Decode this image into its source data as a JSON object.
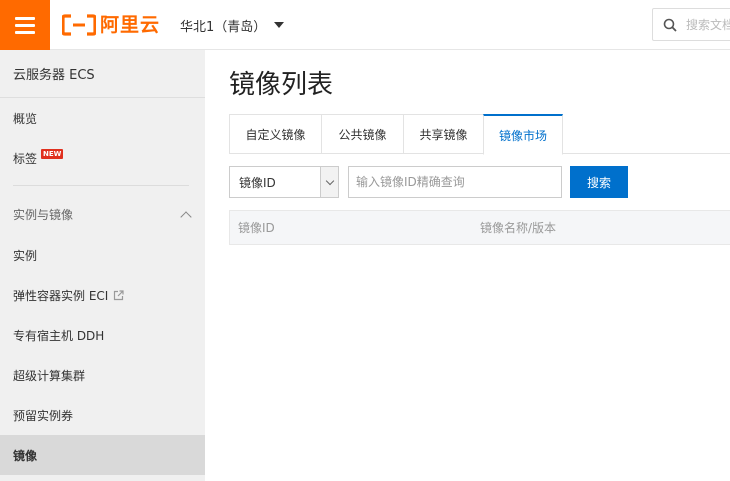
{
  "header": {
    "brand": "阿里云",
    "brand_color": "#ff6a00",
    "region": "华北1（青岛）",
    "search_placeholder": "搜索文档"
  },
  "sidebar": {
    "title": "云服务器 ECS",
    "items_top": [
      {
        "label": "概览"
      },
      {
        "label": "标签",
        "badge": "NEW"
      }
    ],
    "group_label": "实例与镜像",
    "group_items": [
      {
        "label": "实例"
      },
      {
        "label": "弹性容器实例 ECI",
        "external": true
      },
      {
        "label": "专有宿主机 DDH"
      },
      {
        "label": "超级计算集群"
      },
      {
        "label": "预留实例券"
      },
      {
        "label": "镜像",
        "active": true
      }
    ]
  },
  "main": {
    "title": "镜像列表",
    "tabs": [
      {
        "label": "自定义镜像"
      },
      {
        "label": "公共镜像"
      },
      {
        "label": "共享镜像"
      },
      {
        "label": "镜像市场",
        "active": true
      }
    ],
    "filter": {
      "selected": "镜像ID",
      "placeholder": "输入镜像ID精确查询",
      "search_label": "搜索"
    },
    "table": {
      "columns": [
        "镜像ID",
        "镜像名称/版本"
      ]
    },
    "accent_color": "#0070cc"
  }
}
